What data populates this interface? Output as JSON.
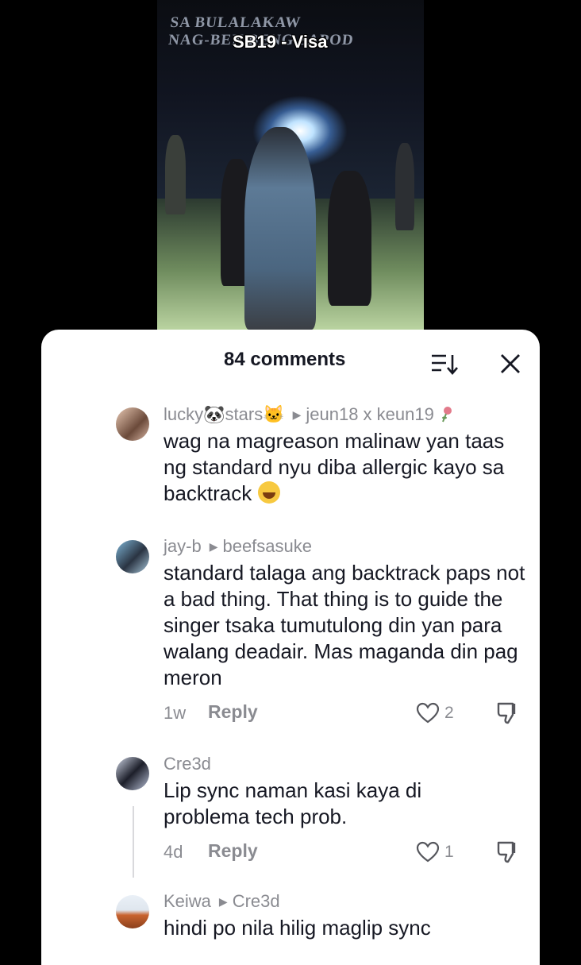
{
  "video": {
    "stage_sign_line1": "SA BULALAKAW",
    "stage_sign_line2": "NAG-BEN    BENG SAPOD",
    "caption": "SB19 - Visa"
  },
  "sheet": {
    "comment_count": "84 comments",
    "sort_icon": "sort-icon",
    "close_icon": "close-icon"
  },
  "comments": [
    {
      "author": "lucky🐼stars🐱",
      "reply_to": "jeun18 x keun19",
      "reply_to_icon": "rose-icon",
      "text": "wag na magreason malinaw yan taas ng standard nyu diba allergic kayo sa backtrack",
      "emoji": "joy-emoji"
    },
    {
      "author": "jay-b",
      "reply_to": "beefsasuke",
      "text": "standard talaga ang backtrack paps not a bad thing. That thing is to guide the singer tsaka tumutulong din yan para walang deadair. Mas maganda din pag meron",
      "time": "1w",
      "reply_label": "Reply",
      "likes": "2"
    },
    {
      "author": "Cre3d",
      "text": "Lip sync naman kasi kaya di problema tech prob.",
      "time": "4d",
      "reply_label": "Reply",
      "likes": "1"
    },
    {
      "author": "Keiwa",
      "reply_to": "Cre3d",
      "text": "hindi po nila hilig maglip sync"
    }
  ],
  "colors": {
    "text_primary": "#161823",
    "text_secondary": "#8a8b91",
    "sheet_bg": "#ffffff",
    "page_bg": "#000000"
  }
}
